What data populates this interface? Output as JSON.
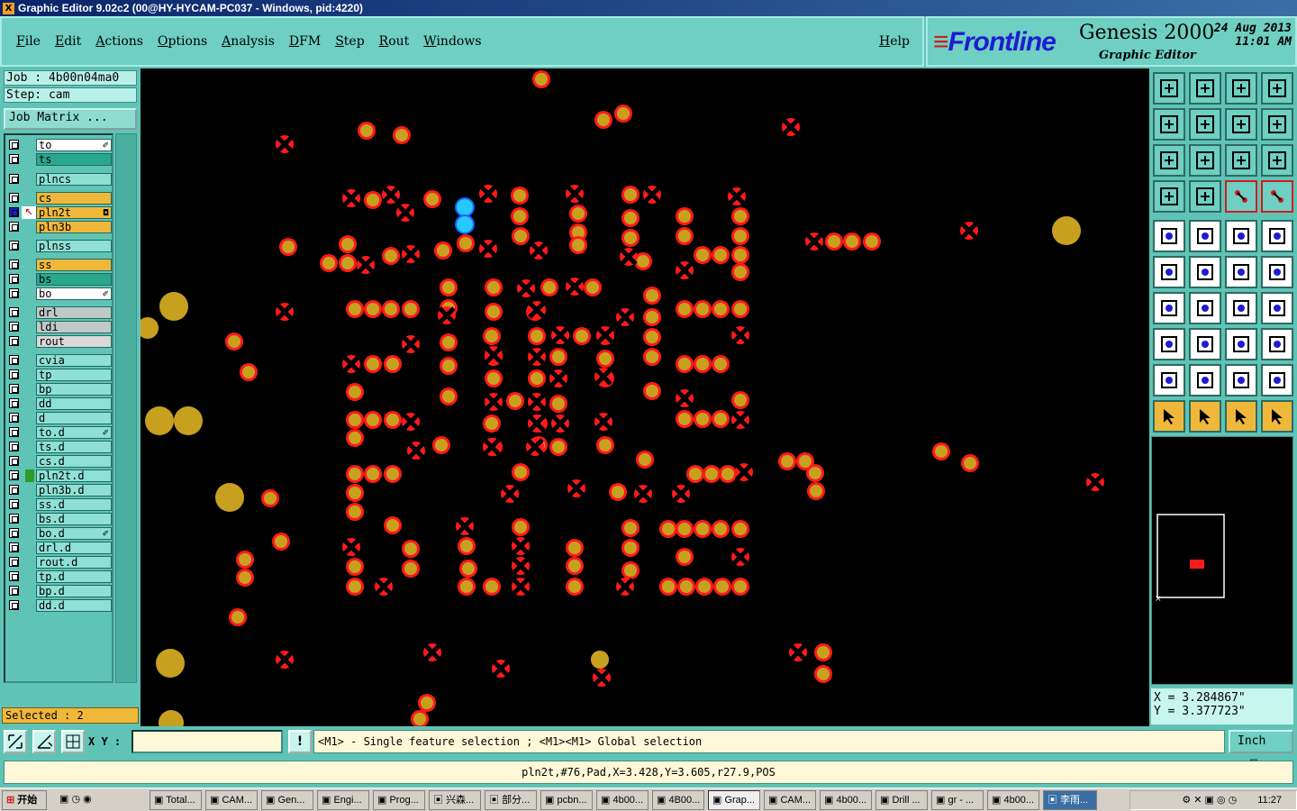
{
  "window": {
    "title": "Graphic Editor 9.02c2 (00@HY-HYCAM-PC037 - Windows, pid:4220)"
  },
  "menu": {
    "items": [
      "File",
      "Edit",
      "Actions",
      "Options",
      "Analysis",
      "DFM",
      "Step",
      "Rout",
      "Windows"
    ],
    "help": "Help"
  },
  "brand": {
    "logo": "Frontline",
    "product": "Genesis 2000",
    "subtitle": "Graphic Editor",
    "date": "24 Aug 2013",
    "time": "11:01 AM"
  },
  "job": {
    "job_text": "Job : 4b00n04ma0",
    "step_text": "Step: cam",
    "matrix_button": "Job Matrix ..."
  },
  "layers": [
    {
      "name": "to",
      "color": "#ffffff",
      "tag": "✐"
    },
    {
      "name": "ts",
      "color": "#2aa88c",
      "tag": ""
    },
    {
      "name": "plncs",
      "color": "#8fe0d4",
      "tag": ""
    },
    {
      "name": "cs",
      "color": "#f0b83a",
      "tag": ""
    },
    {
      "name": "pln2t",
      "color": "#f0b83a",
      "tag": "◘",
      "active": true
    },
    {
      "name": "pln3b",
      "color": "#f0b83a",
      "tag": ""
    },
    {
      "name": "plnss",
      "color": "#8fe0d4",
      "tag": ""
    },
    {
      "name": "ss",
      "color": "#f0b83a",
      "tag": ""
    },
    {
      "name": "bs",
      "color": "#2aa88c",
      "tag": ""
    },
    {
      "name": "bo",
      "color": "#ffffff",
      "tag": "✐"
    },
    {
      "name": "drl",
      "color": "#c0c8c8",
      "tag": ""
    },
    {
      "name": "ldi",
      "color": "#c0c8c8",
      "tag": ""
    },
    {
      "name": "rout",
      "color": "#d8d8d8",
      "tag": ""
    },
    {
      "name": "cvia",
      "color": "#8fe0d4",
      "tag": ""
    },
    {
      "name": "tp",
      "color": "#8fe0d4",
      "tag": ""
    },
    {
      "name": "bp",
      "color": "#8fe0d4",
      "tag": ""
    },
    {
      "name": "dd",
      "color": "#8fe0d4",
      "tag": ""
    },
    {
      "name": "d",
      "color": "#8fe0d4",
      "tag": ""
    },
    {
      "name": "to.d",
      "color": "#8fe0d4",
      "tag": "✐"
    },
    {
      "name": "ts.d",
      "color": "#8fe0d4",
      "tag": ""
    },
    {
      "name": "cs.d",
      "color": "#8fe0d4",
      "tag": ""
    },
    {
      "name": "pln2t.d",
      "color": "#8fe0d4",
      "tag": "",
      "marker": "#2d9a2d"
    },
    {
      "name": "pln3b.d",
      "color": "#8fe0d4",
      "tag": ""
    },
    {
      "name": "ss.d",
      "color": "#8fe0d4",
      "tag": ""
    },
    {
      "name": "bs.d",
      "color": "#8fe0d4",
      "tag": ""
    },
    {
      "name": "bo.d",
      "color": "#8fe0d4",
      "tag": "✐"
    },
    {
      "name": "drl.d",
      "color": "#8fe0d4",
      "tag": ""
    },
    {
      "name": "rout.d",
      "color": "#8fe0d4",
      "tag": ""
    },
    {
      "name": "tp.d",
      "color": "#8fe0d4",
      "tag": ""
    },
    {
      "name": "bp.d",
      "color": "#8fe0d4",
      "tag": ""
    },
    {
      "name": "dd.d",
      "color": "#8fe0d4",
      "tag": ""
    }
  ],
  "selected": {
    "text": "Selected : 2"
  },
  "coords": {
    "x_text": "X = 3.284867\"",
    "y_text": "Y = 3.377723\""
  },
  "bottom": {
    "xy_label": "X Y :",
    "xy_value": "",
    "prompt": "<M1> - Single feature selection ; <M1><M1> Global selection",
    "units": "Inch",
    "feature_info": "pln2t,#76,Pad,X=3.428,Y=3.605,r27.9,POS"
  },
  "taskbar": {
    "start": "开始",
    "tasks": [
      "Total...",
      "CAM...",
      "Gen...",
      "Engi...",
      "Prog...",
      "兴森...",
      "部分...",
      "pcbn...",
      "4b00...",
      "4B00...",
      "Grap...",
      "CAM...",
      "4b00...",
      "Drill ...",
      "gr - ...",
      "4b00...",
      "李雨..."
    ],
    "clock": "11:27"
  },
  "colors": {
    "pad": "#ff1a1a",
    "pad_center": "#c8a020",
    "selected_pad": "#28c8ff",
    "canvas": "#000000"
  }
}
